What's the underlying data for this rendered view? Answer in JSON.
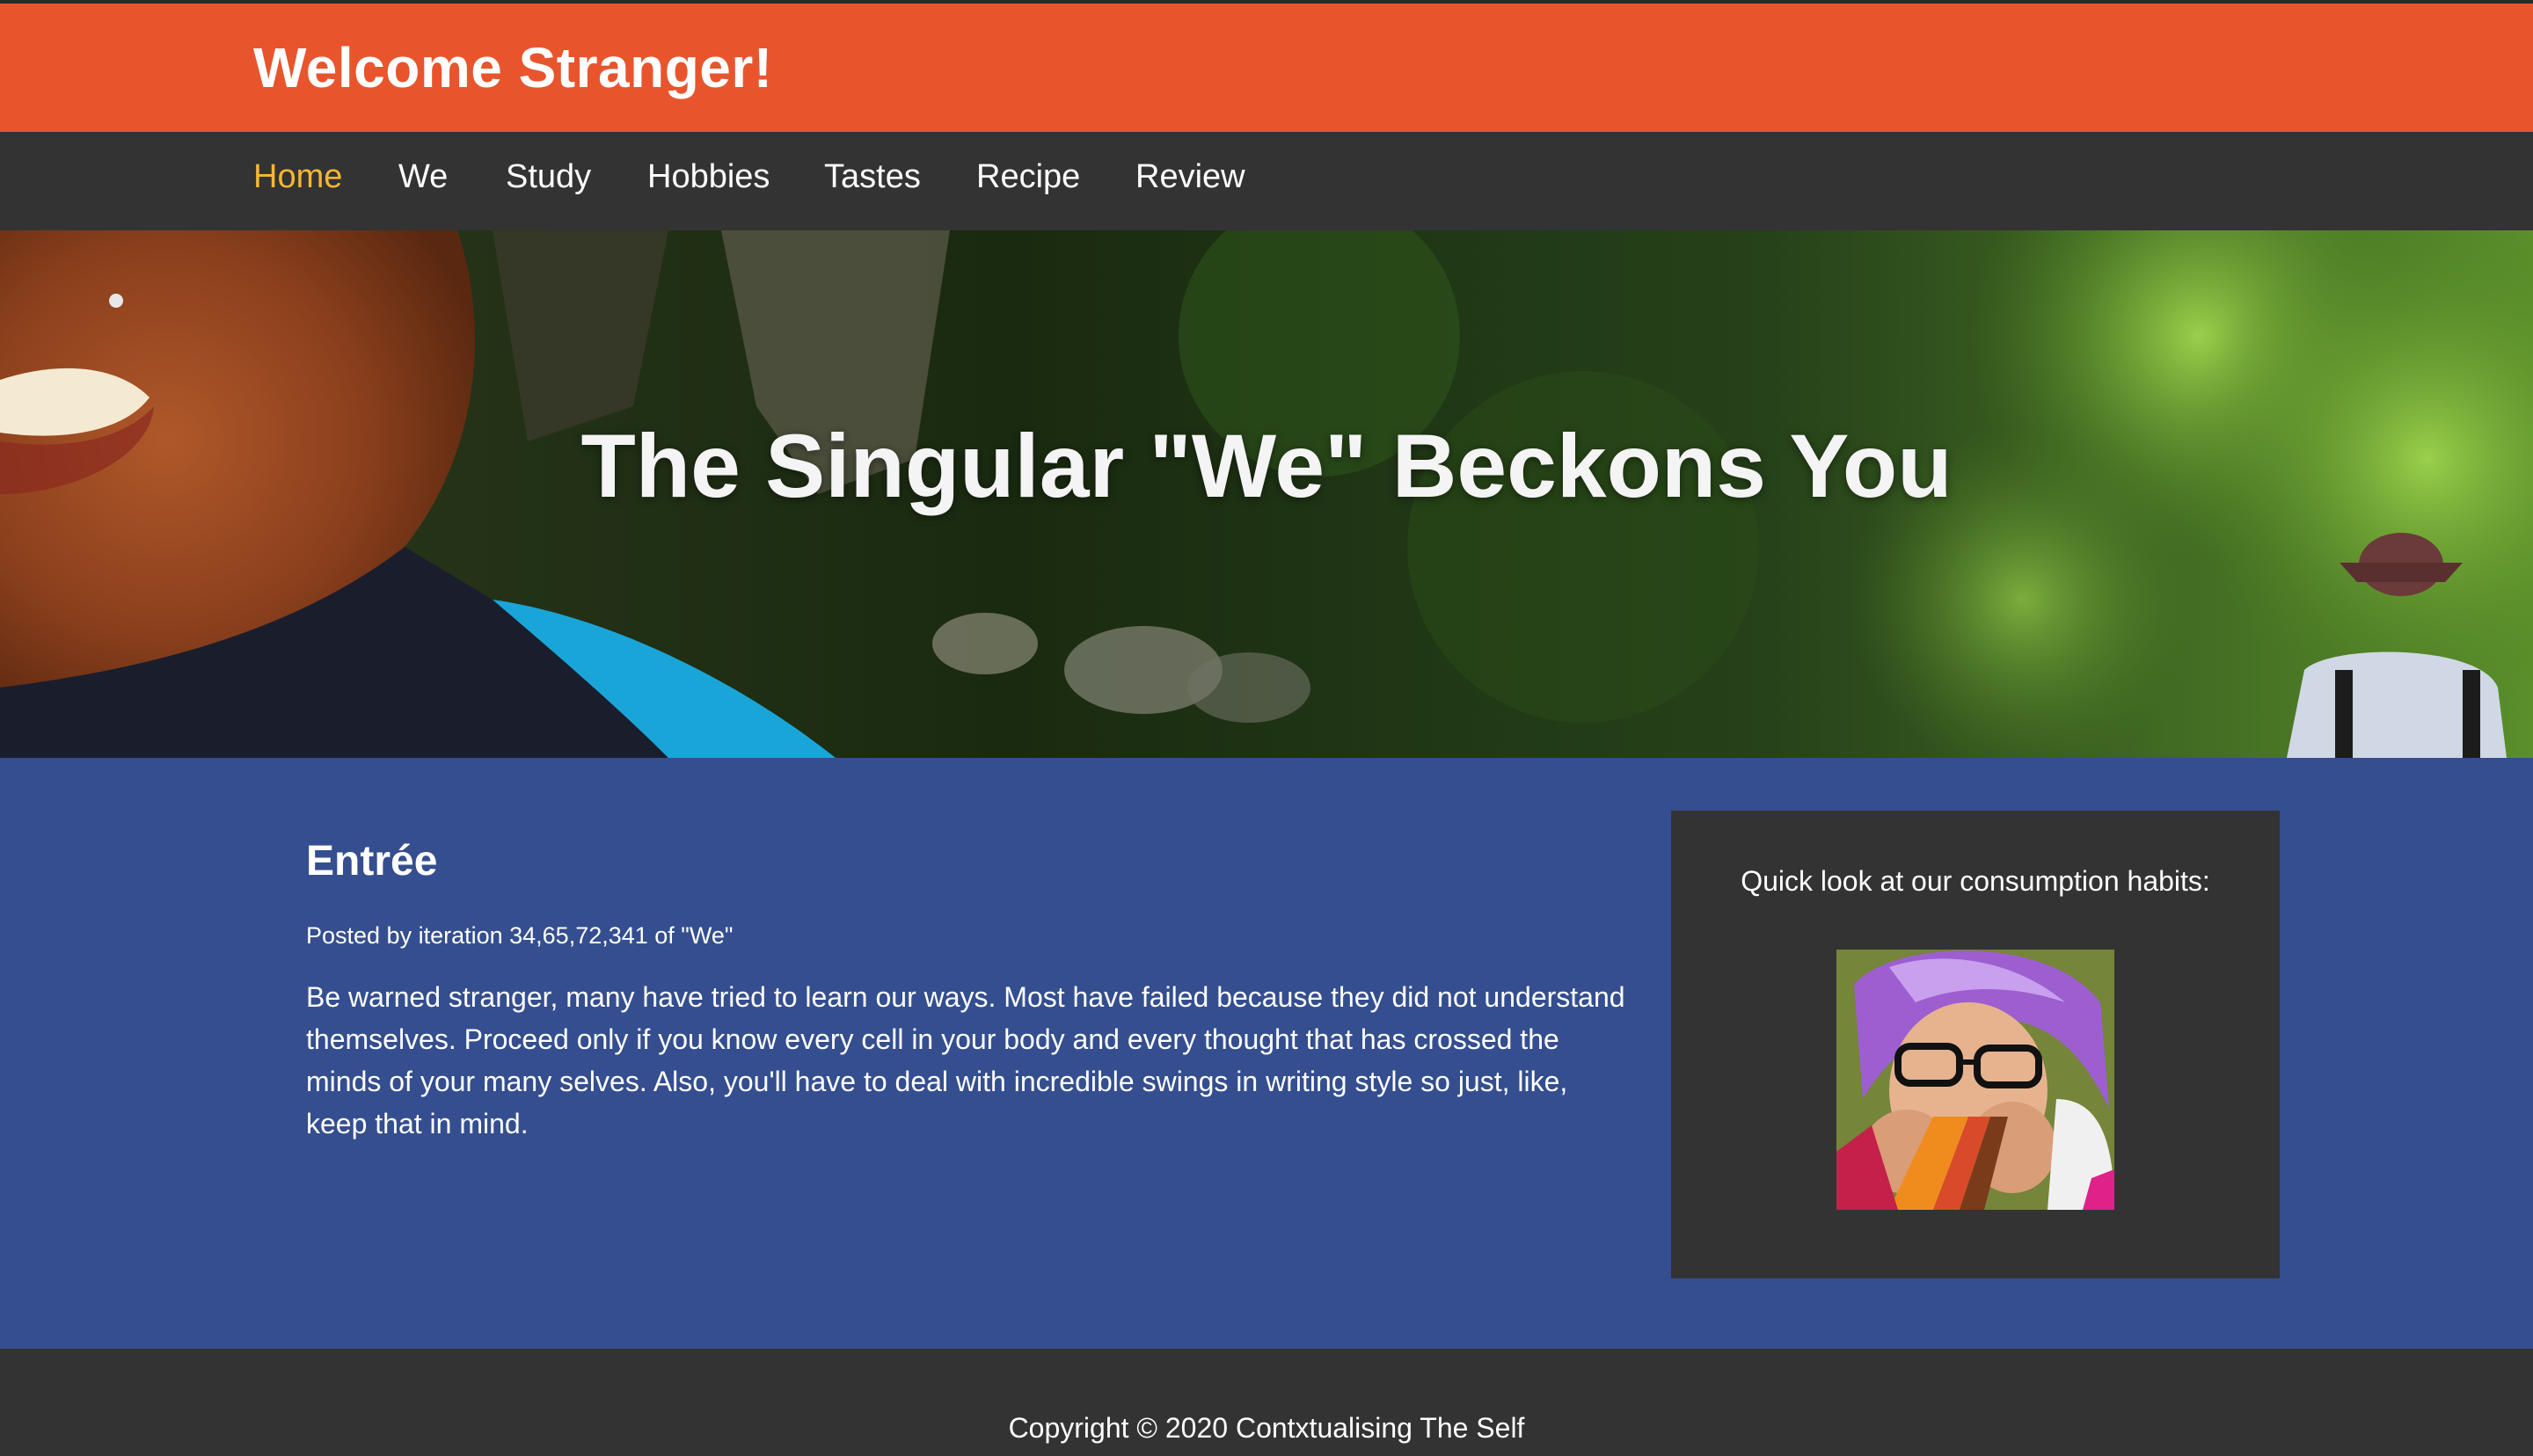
{
  "header": {
    "title": "Welcome Stranger!",
    "bg_color": "#e8552d"
  },
  "nav": {
    "items": [
      {
        "label": "Home",
        "active": true
      },
      {
        "label": "We"
      },
      {
        "label": "Study"
      },
      {
        "label": "Hobbies"
      },
      {
        "label": "Tastes"
      },
      {
        "label": "Recipe"
      },
      {
        "label": "Review"
      }
    ],
    "active_color": "#f5b731"
  },
  "hero": {
    "title": "The Singular \"We\" Beckons You"
  },
  "article": {
    "title": "Entrée",
    "meta": "Posted by iteration 34,65,72,341 of \"We\"",
    "body": "Be warned stranger, many have tried to learn our ways. Most have failed because they did not understand themselves. Proceed only if you know every cell in your body and every thought that has crossed the minds of your many selves. Also, you'll have to deal with incredible swings in writing style so just, like, keep that in mind."
  },
  "sidebar": {
    "title": "Quick look at our consumption habits:"
  },
  "footer": {
    "copyright": "Copyright © 2020 Contxtualising The Self"
  },
  "colors": {
    "content_bg": "#344e8f",
    "dark_bg": "#333333"
  }
}
